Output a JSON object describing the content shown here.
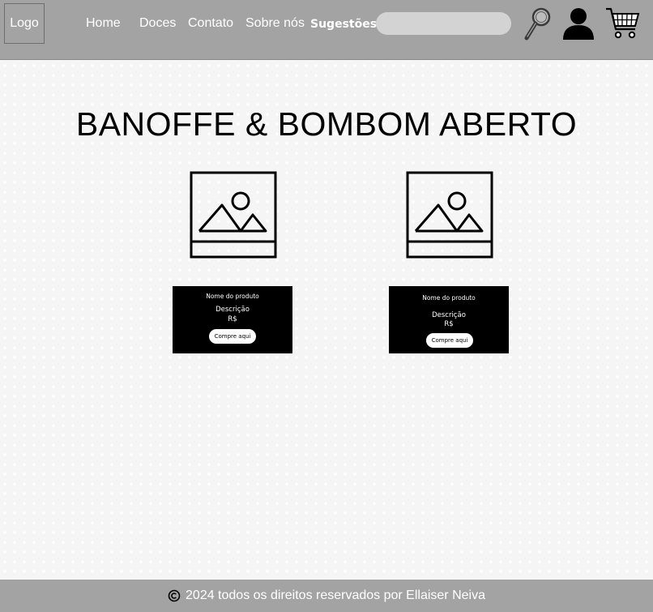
{
  "header": {
    "logo_label": "Logo",
    "nav": {
      "home": "Home",
      "doces": "Doces",
      "contato": "Contato",
      "sobre": "Sobre nós",
      "sugestoes": "Sugestões"
    },
    "search": {
      "value": "",
      "placeholder": ""
    },
    "icons": [
      "search-icon",
      "user-icon",
      "cart-icon"
    ]
  },
  "main": {
    "title": "BANOFFE & BOMBOM ABERTO",
    "products": [
      {
        "image_icon": "image-placeholder-icon",
        "name": "Nome do produto",
        "description": "Descrição",
        "price": "R$",
        "button": "Compre aqui"
      },
      {
        "image_icon": "image-placeholder-icon",
        "name": "Nome do produto",
        "description": "Descrição",
        "price": "R$",
        "button": "Compre aqui"
      }
    ]
  },
  "footer": {
    "text": "2024 todos os direitos reservados por Ellaiser Neiva"
  },
  "colors": {
    "header_bg": "#a3a3a3",
    "footer_bg": "#a3a3a3",
    "card_bg": "#000000",
    "page_bg": "#f5f5f5"
  }
}
